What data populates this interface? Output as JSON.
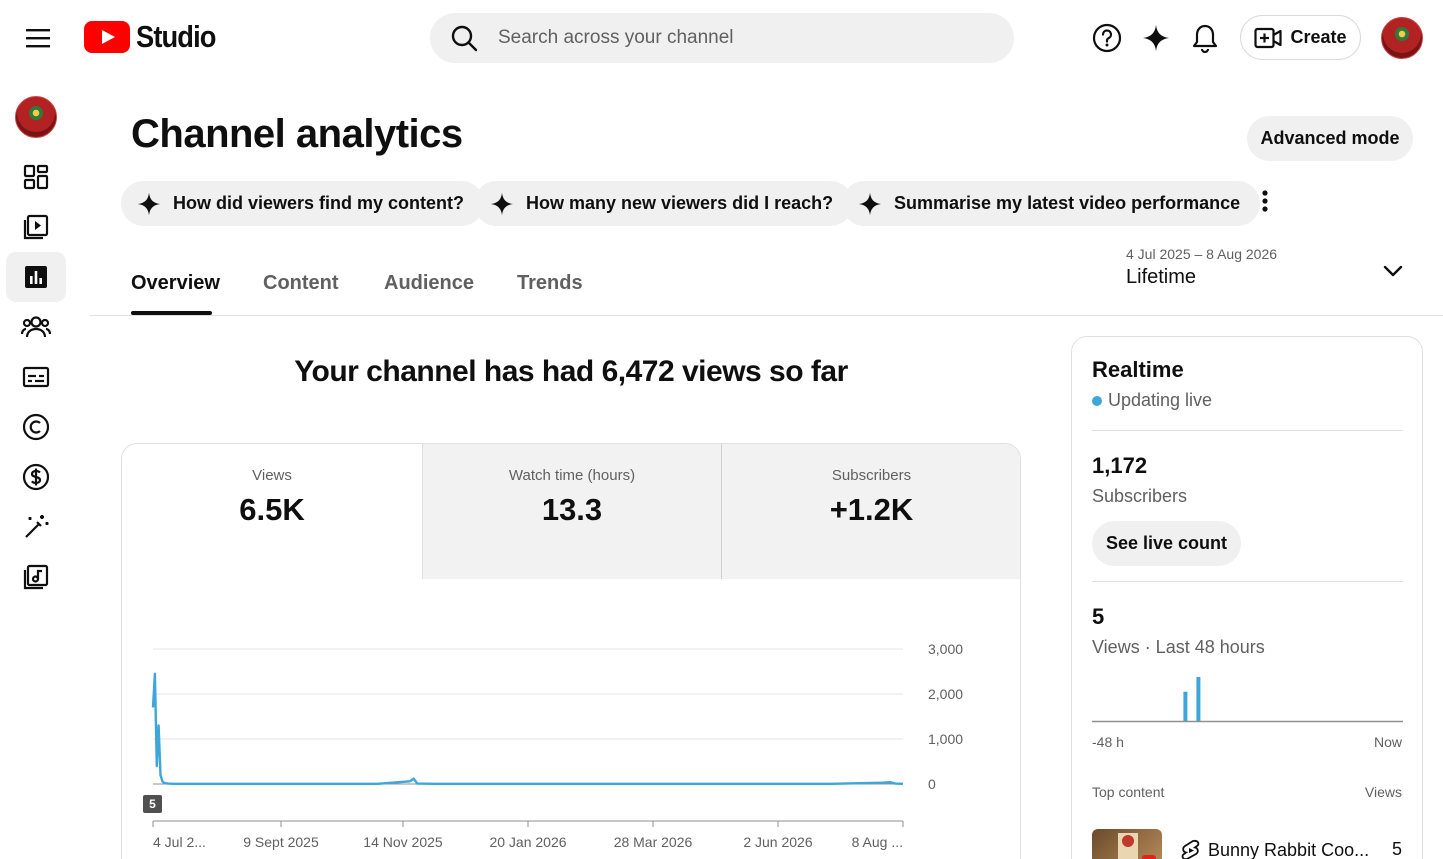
{
  "app": {
    "logo_text": "Studio",
    "search_placeholder": "Search across your channel",
    "create_label": "Create"
  },
  "header": {
    "title": "Channel analytics",
    "advanced_mode_label": "Advanced mode",
    "suggestions": [
      "How did viewers find my content?",
      "How many new viewers did I reach?",
      "Summarise my latest video performance"
    ]
  },
  "tabs": [
    "Overview",
    "Content",
    "Audience",
    "Trends"
  ],
  "date_filter": {
    "range": "4 Jul 2025 – 8 Aug 2026",
    "period": "Lifetime"
  },
  "overview": {
    "headline": "Your channel has had 6,472 views so far",
    "metrics": [
      {
        "label": "Views",
        "value": "6.5K"
      },
      {
        "label": "Watch time (hours)",
        "value": "13.3"
      },
      {
        "label": "Subscribers",
        "value": "+1.2K"
      }
    ],
    "video_marker": "5"
  },
  "chart_data": {
    "type": "line",
    "title": "",
    "xlabel": "",
    "ylabel": "",
    "ylim": [
      0,
      3000
    ],
    "y_ticks": [
      "3,000",
      "2,000",
      "1,000",
      "0"
    ],
    "x_ticks": [
      "4 Jul 2...",
      "9 Sept 2025",
      "14 Nov 2025",
      "20 Jan 2026",
      "28 Mar 2026",
      "2 Jun 2026",
      "8 Aug ..."
    ],
    "grid": true,
    "series": [
      {
        "color": "#3ea6d8",
        "x": [
          "2025-07-04",
          "2025-07-05",
          "2025-07-06",
          "2025-07-07",
          "2025-07-08",
          "2025-07-09",
          "2025-07-10",
          "2025-07-12",
          "2025-07-15",
          "2025-07-20",
          "2025-08-01",
          "2025-09-01",
          "2025-10-01",
          "2025-11-01",
          "2025-11-18",
          "2025-11-20",
          "2025-11-22",
          "2025-12-01",
          "2026-01-01",
          "2026-02-01",
          "2026-03-01",
          "2026-04-01",
          "2026-05-01",
          "2026-06-01",
          "2026-07-01",
          "2026-07-28",
          "2026-08-01",
          "2026-08-04",
          "2026-08-08"
        ],
        "values": [
          1700,
          2450,
          400,
          1300,
          200,
          60,
          20,
          10,
          5,
          5,
          5,
          5,
          5,
          5,
          60,
          120,
          10,
          5,
          5,
          5,
          5,
          5,
          5,
          5,
          5,
          30,
          40,
          10,
          5
        ]
      }
    ]
  },
  "realtime": {
    "title": "Realtime",
    "status": "Updating live",
    "subscribers_value": "1,172",
    "subscribers_label": "Subscribers",
    "live_count_label": "See live count",
    "views_value": "5",
    "views_label": "Views · Last 48 hours",
    "axis_start": "-48 h",
    "axis_end": "Now",
    "top_content_label": "Top content",
    "views_col_label": "Views",
    "top_item_title": "Bunny Rabbit Coo...",
    "top_item_views": "5"
  },
  "realtime_chart": {
    "type": "bar",
    "hours": 48,
    "values": [
      0,
      0,
      0,
      0,
      0,
      0,
      0,
      0,
      0,
      0,
      0,
      0,
      0,
      0,
      0,
      0,
      0,
      0,
      0,
      0,
      0,
      0,
      0,
      0,
      0,
      0,
      0,
      0,
      0,
      0,
      0,
      0,
      0,
      0,
      0,
      0,
      0,
      0,
      0,
      0,
      0,
      0,
      0,
      0,
      0,
      0,
      0,
      0
    ],
    "bars": [
      {
        "hour_index": 14,
        "value": 2
      },
      {
        "hour_index": 16,
        "value": 3
      }
    ],
    "ymax": 3
  },
  "colors": {
    "brand_red": "#ff0000",
    "accent_blue": "#3ea6d8",
    "chip_bg": "#f0f0f0"
  }
}
